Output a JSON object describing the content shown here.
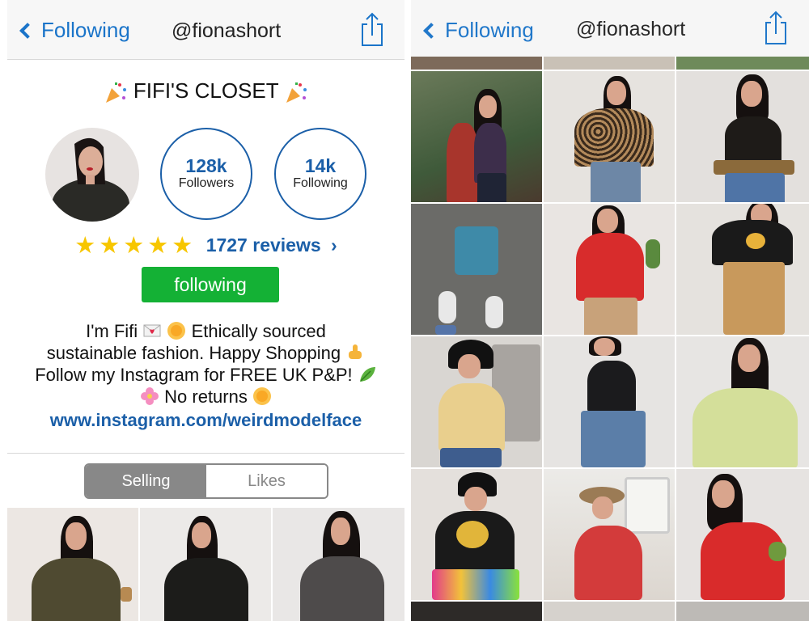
{
  "left": {
    "nav": {
      "back_label": "Following",
      "title": "@fionashort"
    },
    "shop_title": "FIFI'S CLOSET",
    "stats": [
      {
        "num": "128k",
        "label": "Followers"
      },
      {
        "num": "14k",
        "label": "Following"
      }
    ],
    "rating": {
      "stars": 5,
      "stars_text": "★★★★★",
      "reviews": "1727 reviews"
    },
    "follow_button": "following",
    "bio": {
      "line1_a": "I'm Fifi",
      "line1_b": "Ethically sourced",
      "line2": "sustainable fashion. Happy Shopping",
      "line3": "Follow my Instagram for FREE UK P&P!",
      "line4": "No returns",
      "link": "www.instagram.com/weirdmodelface"
    },
    "tabs": [
      {
        "label": "Selling",
        "active": true
      },
      {
        "label": "Likes",
        "active": false
      }
    ]
  },
  "right": {
    "nav": {
      "back_label": "Following",
      "title": "@fionashort"
    }
  },
  "colors": {
    "accent_blue": "#1a74c9",
    "follow_green": "#14b135",
    "star_yellow": "#f7c600",
    "segment_gray": "#888888"
  },
  "icons": [
    "chevron-left-icon",
    "share-icon",
    "party-popper-icon",
    "star-icon",
    "chevron-right-icon",
    "love-letter-icon",
    "sun-icon",
    "pointing-down-icon",
    "leaf-icon",
    "flower-icon"
  ]
}
